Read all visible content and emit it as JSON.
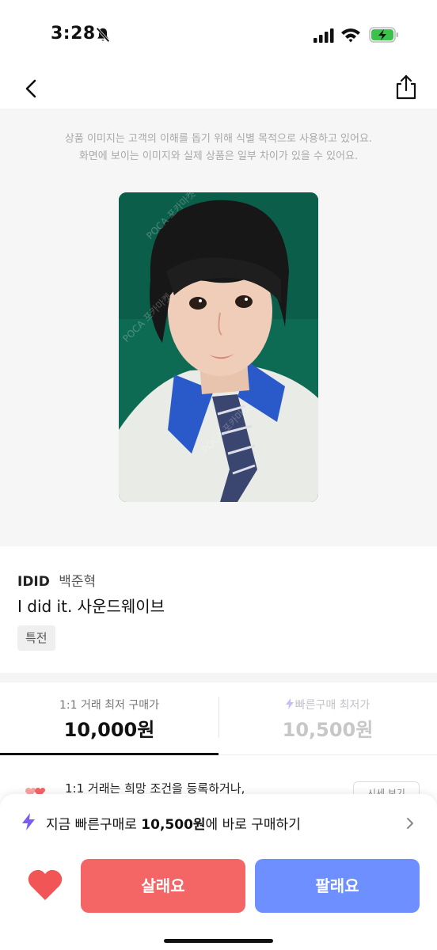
{
  "status_bar": {
    "time": "3:28",
    "icons": [
      "bell-slash-icon",
      "cellular-signal-icon",
      "wifi-icon",
      "battery-charging-icon"
    ],
    "battery_color": "#3bc24a"
  },
  "nav": {
    "back_icon": "chevron-left-icon",
    "share_icon": "share-icon"
  },
  "image_area": {
    "notice_line1": "상품 이미지는 고객의 이해를 돕기 위해 식별 목적으로 사용하고 있어요.",
    "notice_line2": "화면에 보이는 이미지와 실제 상품은 일부 차이가 있을 수 있어요."
  },
  "product": {
    "group": "IDID",
    "member": "백준혁",
    "album": "I did it. 사운드웨이브",
    "tag": "특전"
  },
  "price_tabs": [
    {
      "label": "1:1 거래 최저 구매가",
      "price": "10,000원",
      "selected": true
    },
    {
      "label": "빠른구매 최저가",
      "price": "10,500원",
      "selected": false
    }
  ],
  "hidden_row": {
    "text": "1:1 거래는 희망 조건을 등록하거나,",
    "button": "시세 보기"
  },
  "bottom_sheet": {
    "quick_prefix": "지금 빠른구매로 ",
    "quick_price": "10,500원",
    "quick_suffix": "에 바로 구매하기",
    "buy_label": "살래요",
    "sell_label": "팔래요"
  },
  "colors": {
    "buy": "#f46565",
    "sell": "#6e8fff",
    "bolt": "#7a5cf5",
    "heart": "#f25555"
  }
}
